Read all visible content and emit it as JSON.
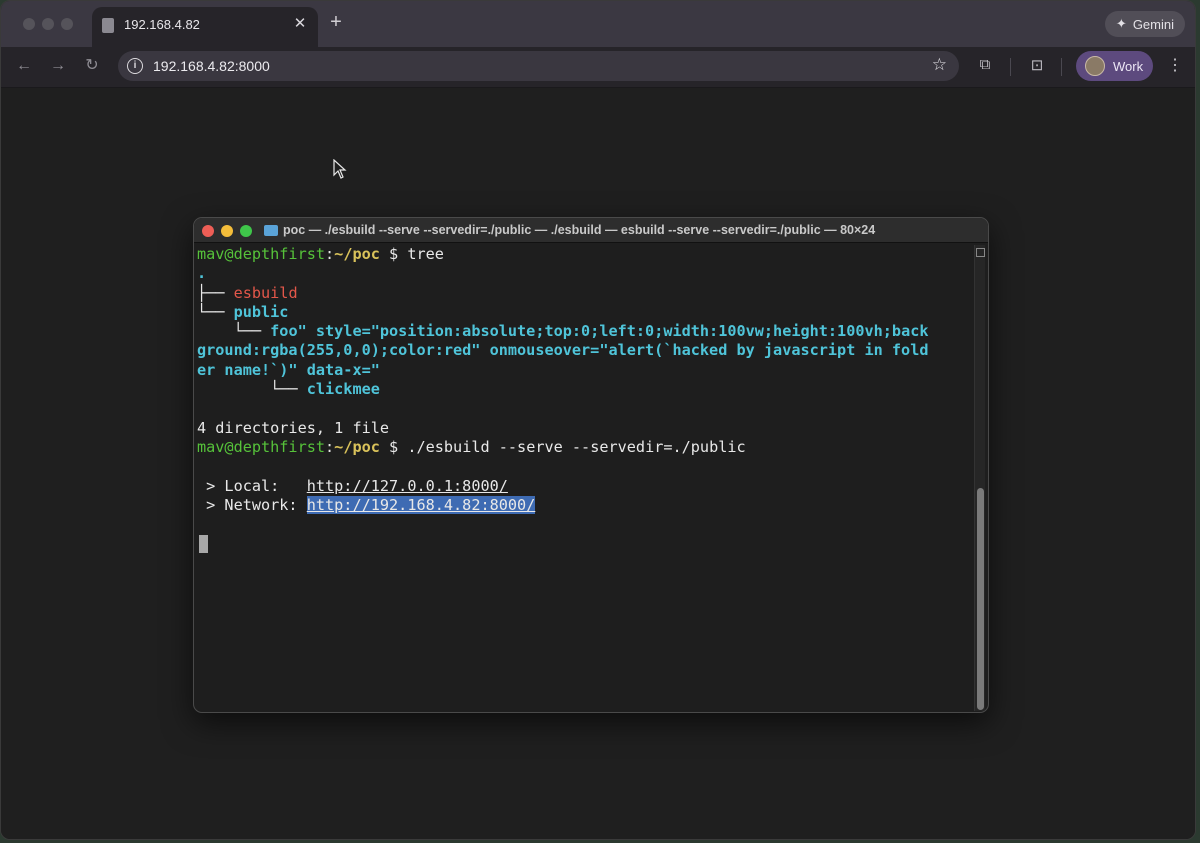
{
  "browser": {
    "tab": {
      "title": "192.168.4.82",
      "close": "✕"
    },
    "new_tab": "+",
    "gemini_label": "Gemini",
    "url": "192.168.4.82:8000",
    "profile_label": "Work",
    "icons": {
      "back": "arrow-left-icon",
      "forward": "arrow-right-icon",
      "reload": "reload-icon",
      "info": "info-icon",
      "bookmark": "star-icon",
      "extensions": "puzzle-icon",
      "cast": "screen-search-icon",
      "menu": "kebab-menu-icon"
    }
  },
  "terminal": {
    "title": "poc — ./esbuild --serve --servedir=./public — ./esbuild — esbuild --serve --servedir=./public — 80×24",
    "prompt_user": "mav@depthfirst",
    "prompt_sep": ":",
    "prompt_path": "~/poc",
    "prompt_dollar": " $ ",
    "cmd1": "tree",
    "tree_root": ".",
    "tree_branch1": "├── ",
    "tree_item1": "esbuild",
    "tree_branch2": "└── ",
    "tree_item2": "public",
    "tree_branch3": "    └── ",
    "long_name_1": "foo\" style=\"position:absolute;top:0;left:0;width:100vw;height:100vh;back",
    "long_name_2": "ground:rgba(255,0,0);color:red\" onmouseover=\"alert(`hacked by javascript in fold",
    "long_name_3": "er name!`)\" data-x=\"",
    "tree_branch4": "        └── ",
    "tree_item4": "clickmee",
    "summary": "4 directories, 1 file",
    "cmd2": "./esbuild --serve --servedir=./public",
    "local_label": " > Local:   ",
    "local_url": "http://127.0.0.1:8000/",
    "network_label": " > Network: ",
    "network_url": "http://192.168.4.82:8000/"
  },
  "colors": {
    "prompt_user": "#56c23a",
    "prompt_path": "#d9c25a",
    "dir_exec": "#e3574a",
    "dir": "#4fc4d9",
    "selection": "#3e6bb3"
  }
}
